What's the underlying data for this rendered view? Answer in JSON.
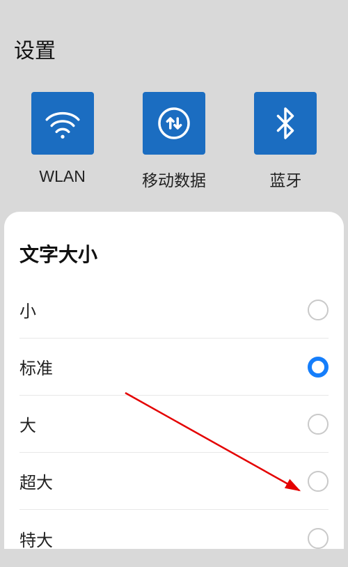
{
  "header": {
    "title": "设置"
  },
  "tiles": [
    {
      "label": "WLAN",
      "icon": "wifi-icon"
    },
    {
      "label": "移动数据",
      "icon": "data-icon"
    },
    {
      "label": "蓝牙",
      "icon": "bluetooth-icon"
    }
  ],
  "textSize": {
    "title": "文字大小",
    "options": [
      {
        "label": "小",
        "selected": false
      },
      {
        "label": "标准",
        "selected": true
      },
      {
        "label": "大",
        "selected": false
      },
      {
        "label": "超大",
        "selected": false
      },
      {
        "label": "特大",
        "selected": false
      }
    ]
  },
  "colors": {
    "tile_bg": "#1b6dc1",
    "accent": "#157efb"
  }
}
